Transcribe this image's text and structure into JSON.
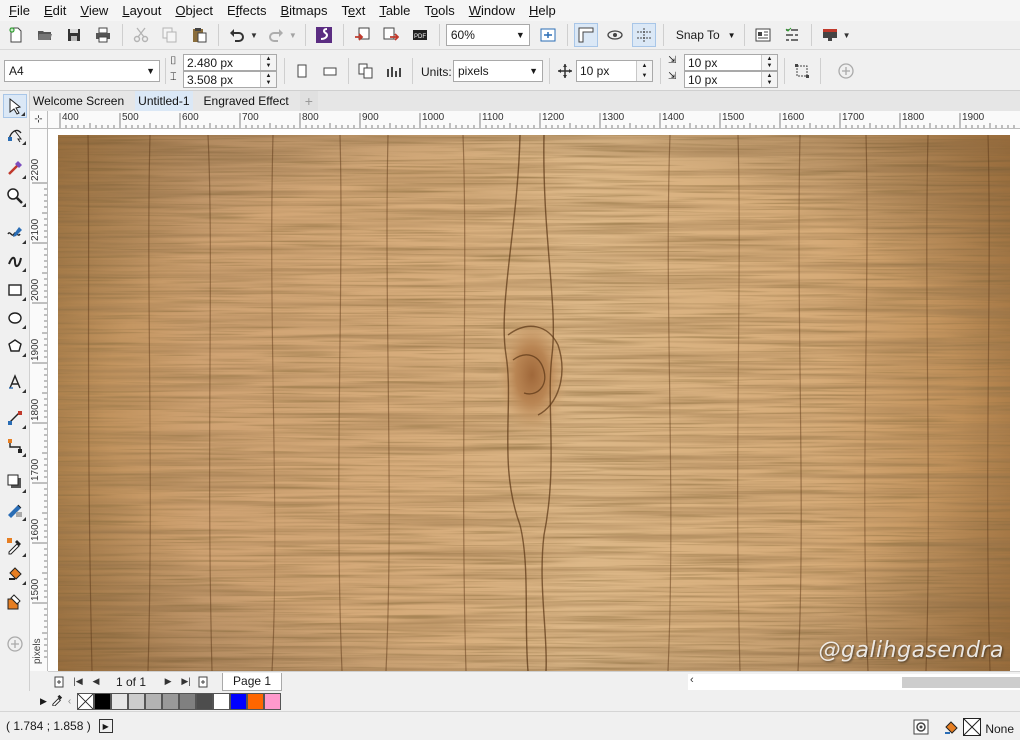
{
  "menu": {
    "items": [
      {
        "label": "File",
        "u": 0
      },
      {
        "label": "Edit",
        "u": 0
      },
      {
        "label": "View",
        "u": 0
      },
      {
        "label": "Layout",
        "u": 0
      },
      {
        "label": "Object",
        "u": 0
      },
      {
        "label": "Effects",
        "u": 1
      },
      {
        "label": "Bitmaps",
        "u": 0
      },
      {
        "label": "Text",
        "u": 1
      },
      {
        "label": "Table",
        "u": 0
      },
      {
        "label": "Tools",
        "u": 1
      },
      {
        "label": "Window",
        "u": 0
      },
      {
        "label": "Help",
        "u": 0
      }
    ]
  },
  "toolbar": {
    "zoom": "60%",
    "snap_to": "Snap To"
  },
  "property_bar": {
    "page_size": "A4",
    "width": "2.480 px",
    "height": "3.508 px",
    "units_label": "Units:",
    "units": "pixels",
    "nudge": "10 px",
    "dup_x": "10 px",
    "dup_y": "10 px"
  },
  "tabs": {
    "items": [
      "Welcome Screen",
      "Untitled-1",
      "Engraved Effect"
    ],
    "active": 1,
    "add": "+"
  },
  "ruler": {
    "h_labels": [
      "400",
      "500",
      "600",
      "700",
      "800",
      "900",
      "1000",
      "1100",
      "1200",
      "1300",
      "1400",
      "1500",
      "1600",
      "1700",
      "1800",
      "1900"
    ],
    "v_labels": [
      "2200",
      "2100",
      "2000",
      "1900",
      "1800",
      "1700",
      "1600",
      "1500"
    ],
    "unit_label": "pixels"
  },
  "canvas": {
    "watermark": "@galihgasendra"
  },
  "page_nav": {
    "count": "1 of 1",
    "page_tab": "Page 1"
  },
  "palette": {
    "colors": [
      "#000000",
      "#e6e6e6",
      "#cccccc",
      "#b3b3b3",
      "#999999",
      "#808080",
      "#4d4d4d",
      "#ffffff",
      "#0000ff",
      "#ff6600",
      "#ff99cc"
    ]
  },
  "status": {
    "coords": "( 1.784 ; 1.858  )",
    "fill_label": "None"
  }
}
